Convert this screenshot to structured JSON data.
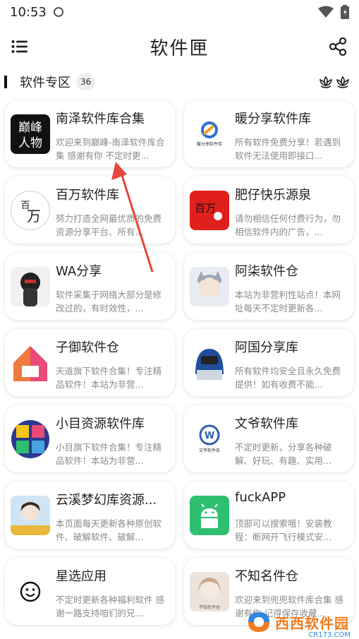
{
  "status": {
    "time": "10:53"
  },
  "header": {
    "title": "软件匣"
  },
  "section": {
    "title": "软件专区",
    "count": "36"
  },
  "cards": [
    {
      "title": "南泽软件库合集",
      "desc": "欢迎来到巅峰-南泽软件库合集 感谢有你 不定时更...",
      "logo_text": "巅峰人物",
      "accent": "#111111"
    },
    {
      "title": "暖分享软件库",
      "desc": "所有软件免费分享！若遇到软件无法使用即接口...",
      "logo_text": "暖分享软件库",
      "accent": "#2e6fd6"
    },
    {
      "title": "百万软件库",
      "desc": "努力打造全网最优质的免费资源分享平台、所有...",
      "logo_text": "百万",
      "accent": "#222222"
    },
    {
      "title": "肥仔快乐源泉",
      "desc": "请勿相信任何付费行为，勿相信软件内的广告，...",
      "logo_text": "百万",
      "accent": "#e0201c"
    },
    {
      "title": "WA分享",
      "desc": "软件采集于网络大部分是修改过的，有时效性，...",
      "logo_text": "",
      "accent": "#333333"
    },
    {
      "title": "阿柒软件仓",
      "desc": "本站为非营利性站点！本网址每天不定时更新各...",
      "logo_text": "",
      "accent": "#9aa7b8"
    },
    {
      "title": "子御软件仓",
      "desc": "天道旗下软件合集！专注精品软件！本站为非营...",
      "logo_text": "",
      "accent": "#e94a7a"
    },
    {
      "title": "阿国分享库",
      "desc": "所有软件均安全且永久免费提供！如有收费不能...",
      "logo_text": "",
      "accent": "#1f4e9c"
    },
    {
      "title": "小目资源软件库",
      "desc": "小目旗下软件合集！专注精品软件！本站为非营...",
      "logo_text": "",
      "accent": "#2b3a8f"
    },
    {
      "title": "文爷软件库",
      "desc": "不定时更新，分享各种破解、好玩、有趣、实用...",
      "logo_text": "文爷软件库",
      "accent": "#2e5fb0"
    },
    {
      "title": "云溪梦幻库资源...",
      "desc": "本页面每天更新各种原创软件、破解软件、破解...",
      "logo_text": "",
      "accent": "#6fa8d8"
    },
    {
      "title": "fuckAPP",
      "desc": "顶部可以搜索哦！安装教程：断网开飞行模式安...",
      "logo_text": "",
      "accent": "#2fbf71"
    },
    {
      "title": "星选应用",
      "desc": "不定时更新各种福利软件 感谢一路支持咱们的兄...",
      "logo_text": "",
      "accent": "#111111"
    },
    {
      "title": "不知名件仓",
      "desc": "欢迎来到兜兜软件库合集 感谢有你 记得保存收藏...",
      "logo_text": "不知名件仓",
      "accent": "#c9a98a"
    }
  ],
  "watermark": {
    "text": "西西软件园",
    "sub": "CR173.COM"
  },
  "colors": {
    "annotation": "#e8453c",
    "card_bg": "#ffffff",
    "desc": "#8a8a8a"
  }
}
